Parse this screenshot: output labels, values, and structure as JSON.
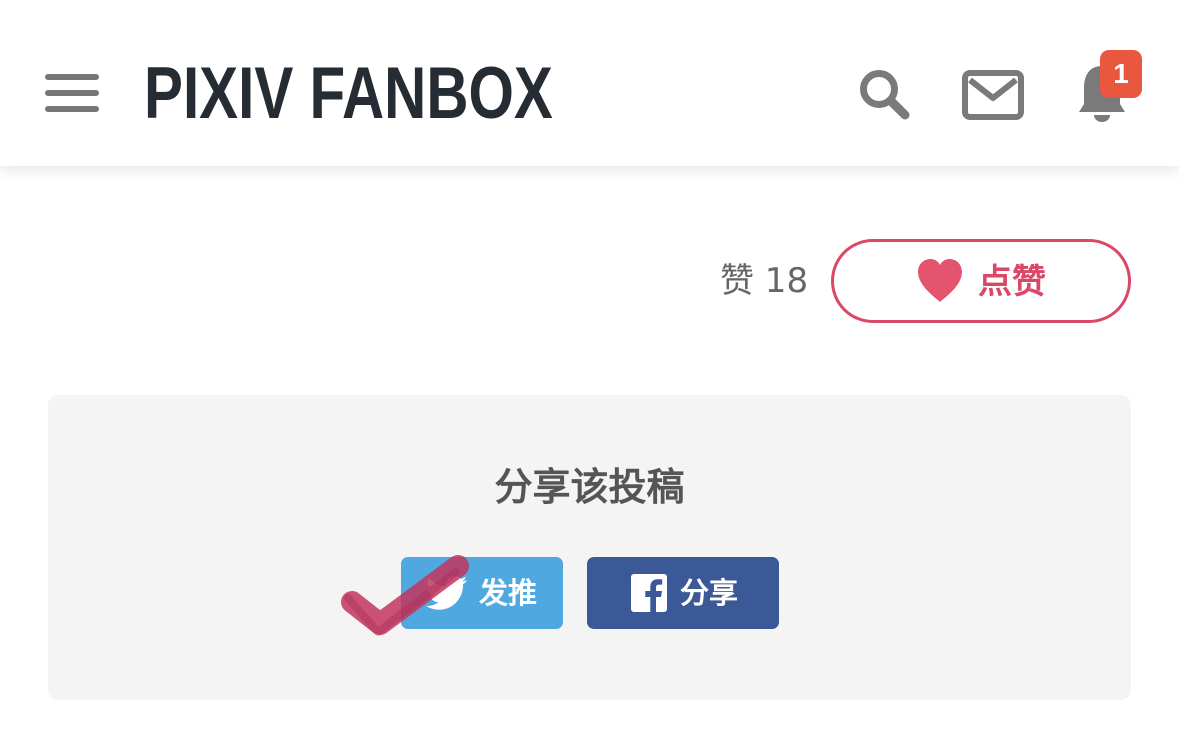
{
  "header": {
    "logo_text": "PIXIV FANBOX",
    "icons": [
      "menu-icon",
      "search-icon",
      "mail-icon",
      "bell-icon"
    ],
    "notification_count": "1",
    "badge_color": "#e9573f"
  },
  "likes": {
    "count_text": "赞 18",
    "button_label": "点赞",
    "accent_color": "#d94866"
  },
  "share": {
    "title": "分享该投稿",
    "twitter_label": "发推",
    "facebook_label": "分享",
    "twitter_color": "#4fa9e0",
    "facebook_color": "#3b5897"
  }
}
